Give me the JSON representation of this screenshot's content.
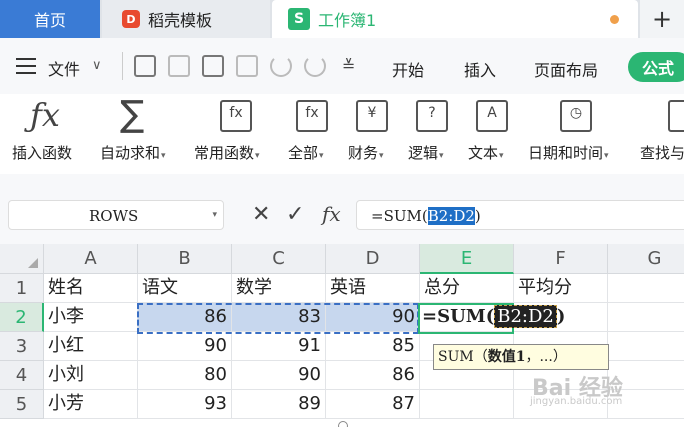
{
  "tabs": {
    "home": "首页",
    "template_logo": "D",
    "template": "稻壳模板",
    "book_logo": "S",
    "book": "工作簿1",
    "plus": "+"
  },
  "menu": {
    "file": "文件",
    "file_chevron": "∨",
    "more": "≚",
    "items": [
      "开始",
      "插入",
      "页面布局"
    ],
    "formula_tab": "公式"
  },
  "ribbon": {
    "items": [
      {
        "label": "插入函数",
        "icon": "fx-icon",
        "glyph": "ƒx"
      },
      {
        "label": "自动求和",
        "icon": "sigma-icon",
        "glyph": "∑",
        "dropdown": true
      },
      {
        "label": "常用函数",
        "icon": "star-fx-icon",
        "glyph": "fx",
        "dropdown": true
      },
      {
        "label": "全部",
        "icon": "fx-box-icon",
        "glyph": "fx",
        "dropdown": true
      },
      {
        "label": "财务",
        "icon": "yen-icon",
        "glyph": "¥",
        "dropdown": true
      },
      {
        "label": "逻辑",
        "icon": "question-icon",
        "glyph": "?",
        "dropdown": true
      },
      {
        "label": "文本",
        "icon": "text-a-icon",
        "glyph": "A",
        "dropdown": true
      },
      {
        "label": "日期和时间",
        "icon": "clock-icon",
        "glyph": "◷",
        "dropdown": true
      },
      {
        "label": "查找与",
        "icon": "lookup-icon",
        "glyph": ""
      }
    ],
    "dropdown_mark": "▾"
  },
  "formula_bar": {
    "name_box": "ROWS",
    "name_box_dd": "▾",
    "cancel": "✕",
    "confirm": "✓",
    "fx": "fx",
    "formula_prefix": "=SUM(",
    "formula_ref": "B2:D2",
    "formula_suffix": ")"
  },
  "grid": {
    "columns": [
      "A",
      "B",
      "C",
      "D",
      "E",
      "F",
      "G"
    ],
    "active_column": "E",
    "rows": [
      {
        "num": "1",
        "cells": [
          "姓名",
          "语文",
          "数学",
          "英语",
          "总分",
          "平均分",
          ""
        ]
      },
      {
        "num": "2",
        "cells": [
          "小李",
          "86",
          "83",
          "90",
          "",
          "",
          ""
        ]
      },
      {
        "num": "3",
        "cells": [
          "小红",
          "90",
          "91",
          "85",
          "",
          "",
          ""
        ]
      },
      {
        "num": "4",
        "cells": [
          "小刘",
          "80",
          "90",
          "86",
          "",
          "",
          ""
        ]
      },
      {
        "num": "5",
        "cells": [
          "小芳",
          "93",
          "89",
          "87",
          "",
          "",
          ""
        ]
      }
    ],
    "active_row": "2",
    "cell_formula_prefix": "=SUM(",
    "cell_formula_ref": "B2:D2",
    "cell_formula_suffix": ")",
    "tooltip_fn": "SUM（",
    "tooltip_arg": "数值1",
    "tooltip_rest": "，...）"
  },
  "watermark": {
    "text": "Bai 经验",
    "sub": "jingyan.baidu.com"
  },
  "colors": {
    "accent_green": "#2bb673",
    "home_tab": "#3a7bd5",
    "selection": "#c7d7ee"
  }
}
